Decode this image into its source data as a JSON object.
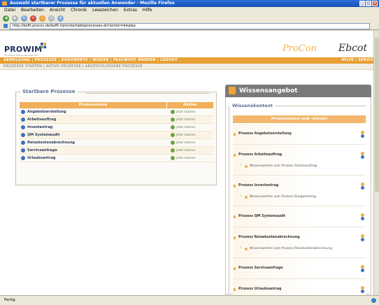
{
  "window": {
    "title": "Auswahl startbarer Prozesse für aktuellen Anwender - Mozilla Firefox"
  },
  "menu": [
    "Datei",
    "Bearbeiten",
    "Ansicht",
    "Chronik",
    "Lesezeichen",
    "Extras",
    "Hilfe"
  ],
  "address": {
    "url": "http://bofit.procon.de/bofit-hpm/startableprocesses.do?action=display"
  },
  "header": {
    "logo": "PROWIM",
    "logo_sub": "Produktion Wissen Management",
    "brand1": "ProCon",
    "brand2": "Ebcot"
  },
  "nav": {
    "primary": "ABMELDUNG | PROZESSE | DOKUMENTE | WISSEN | PASSWORT ÄNDERN | LOGOUT",
    "primary_right": "HILFE  |  SERVICE",
    "secondary": "PROZESSE STARTEN | AKTIVE PROZESSE | ABGESCHLOSSENE PROZESSE"
  },
  "left": {
    "title": "Startbare Prozesse",
    "col_name": "Prozessname",
    "col_action": "Aktion",
    "rows": [
      {
        "name": "Angebotserstellung",
        "action": "jetzt starten"
      },
      {
        "name": "Arbeitsauftrag",
        "action": "jetzt starten"
      },
      {
        "name": "Investantrag",
        "action": "jetzt starten"
      },
      {
        "name": "QM Systemaudit",
        "action": "jetzt starten"
      },
      {
        "name": "Reisekostenabrechnung",
        "action": "jetzt starten"
      },
      {
        "name": "Serviceanfrage",
        "action": "jetzt starten"
      },
      {
        "name": "Urlaubsantrag",
        "action": "jetzt starten"
      }
    ]
  },
  "right": {
    "title": "Wissensangebot",
    "subtitle": "Wissenskontext",
    "table_header": "Prozessname und -wissen",
    "items": [
      {
        "name": "Prozess Angebotserstellung",
        "sub": ""
      },
      {
        "name": "Prozess Arbeitsauftrag",
        "sub": "Wissenswertes zum Prozess Arbeitsauftrag"
      },
      {
        "name": "Prozess Investantrag",
        "sub": "Wissenswertes zum Prozess Budgetantrag"
      },
      {
        "name": "Prozess QM Systemaudit",
        "sub": ""
      },
      {
        "name": "Prozess Reisekostenabrechnung",
        "sub": "Wissenswertes zum Prozess Reisekostenabrechnung"
      },
      {
        "name": "Prozess Serviceanfrage",
        "sub": ""
      },
      {
        "name": "Prozess Urlaubsantrag",
        "sub": ""
      }
    ]
  },
  "status": {
    "text": "Fertig"
  }
}
